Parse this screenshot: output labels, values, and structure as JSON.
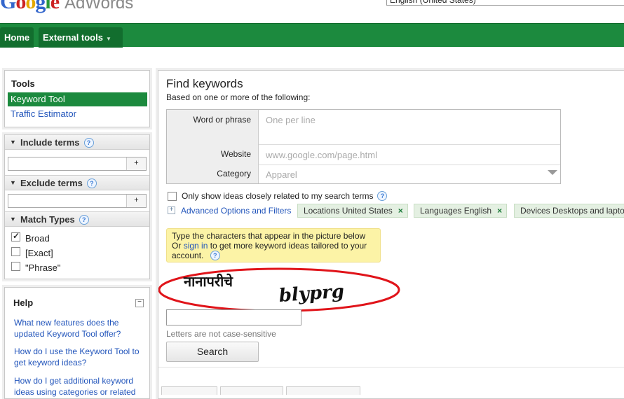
{
  "header": {
    "logo_letters": [
      "G",
      "o",
      "o",
      "g",
      "l",
      "e"
    ],
    "product_name": "AdWords",
    "language_select": "English (United States)"
  },
  "nav": {
    "home": "Home",
    "external_tools": "External tools"
  },
  "tools": {
    "title": "Tools",
    "items": [
      "Keyword Tool",
      "Traffic Estimator"
    ]
  },
  "filters": {
    "include_terms": "Include terms",
    "exclude_terms": "Exclude terms",
    "match_types": "Match Types",
    "add_label": "+",
    "help_glyph": "?",
    "match_options": [
      {
        "label": "Broad",
        "checked": true
      },
      {
        "label": "[Exact]",
        "checked": false
      },
      {
        "label": "\"Phrase\"",
        "checked": false
      }
    ]
  },
  "help": {
    "title": "Help",
    "collapse": "−",
    "links": [
      "What new features does the updated Keyword Tool offer?",
      "How do I use the Keyword Tool to get keyword ideas?",
      "How do I get additional keyword ideas using categories or related"
    ]
  },
  "find": {
    "title": "Find keywords",
    "subtitle": "Based on one or more of the following:",
    "word_label": "Word or phrase",
    "word_placeholder": "One per line",
    "website_label": "Website",
    "website_placeholder": "www.google.com/page.html",
    "category_label": "Category",
    "category_value": "Apparel",
    "only_show": "Only show ideas closely related to my search terms",
    "advanced_link": "Advanced Options and Filters",
    "advanced_plus": "+",
    "chips": [
      "Locations United States",
      "Languages English",
      "Devices Desktops and laptops"
    ],
    "chip_remove": "×"
  },
  "captcha": {
    "note_line1": "Type the characters that appear in the picture below",
    "note_or": "Or",
    "note_signin": "sign in",
    "note_rest": "to get more keyword ideas tailored to your account.",
    "word1": "नानापरीचे",
    "word2": "blyprg",
    "case_note": "Letters are not case-sensitive",
    "search_label": "Search"
  },
  "colors": {
    "nav_green": "#1c8a3e",
    "link_blue": "#2255bb",
    "annotation_red": "#e0141a",
    "note_yellow": "#fcf3a6"
  }
}
